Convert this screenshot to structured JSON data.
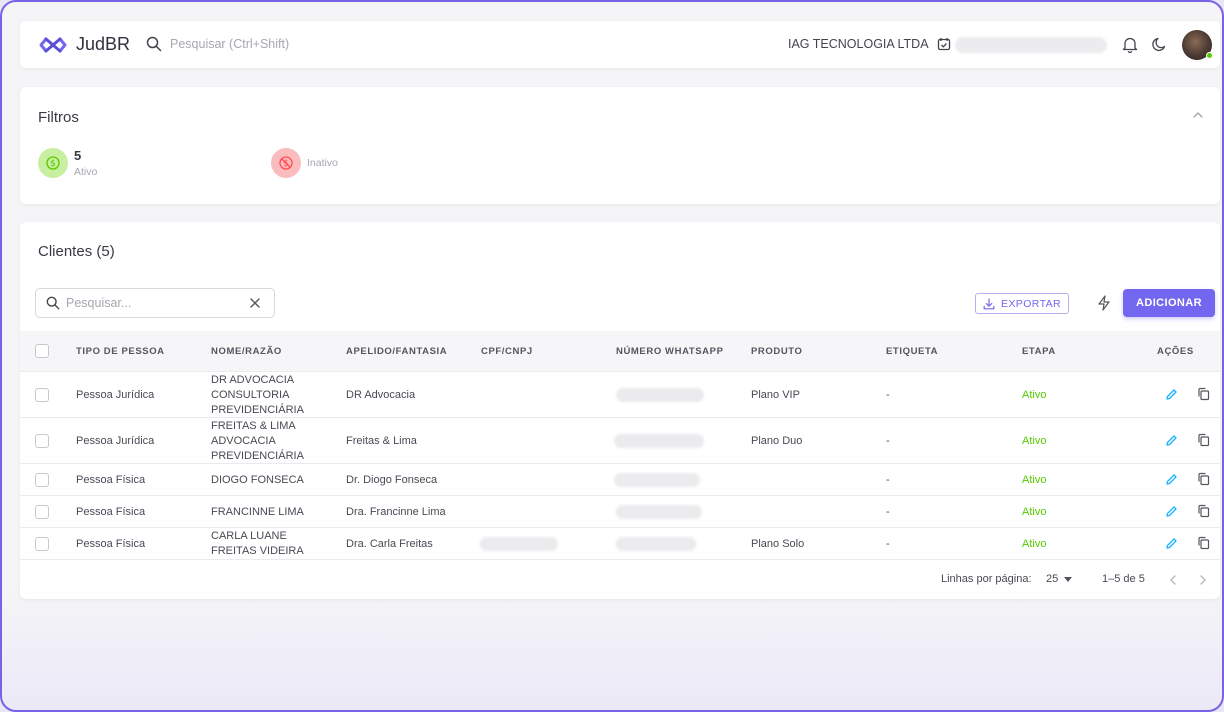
{
  "app": {
    "name": "JudBR"
  },
  "topbar": {
    "search_placeholder": "Pesquisar (Ctrl+Shift)",
    "company": "IAG TECNOLOGIA LTDA"
  },
  "filters": {
    "title": "Filtros",
    "active": {
      "count": "5",
      "label": "Ativo"
    },
    "inactive": {
      "label": "Inativo"
    }
  },
  "clients": {
    "title": "Clientes (5)",
    "search_placeholder": "Pesquisar...",
    "export_label": "EXPORTAR",
    "add_label": "ADICIONAR",
    "columns": [
      "TIPO DE PESSOA",
      "NOME/RAZÃO",
      "APELIDO/FANTASIA",
      "CPF/CNPJ",
      "NÚMERO WHATSAPP",
      "PRODUTO",
      "ETIQUETA",
      "ETAPA",
      "AÇÕES"
    ],
    "rows": [
      {
        "tipo": "Pessoa Jurídica",
        "nome": "DR ADVOCACIA CONSULTORIA PREVIDENCIÁRIA",
        "apelido": "DR Advocacia",
        "produto": "Plano VIP",
        "etiqueta": "-",
        "etapa": "Ativo"
      },
      {
        "tipo": "Pessoa Jurídica",
        "nome": "FREITAS & LIMA ADVOCACIA PREVIDENCIÁRIA",
        "apelido": "Freitas & Lima",
        "produto": "Plano Duo",
        "etiqueta": "-",
        "etapa": "Ativo"
      },
      {
        "tipo": "Pessoa Física",
        "nome": "DIOGO FONSECA",
        "apelido": "Dr. Diogo Fonseca",
        "produto": "",
        "etiqueta": "-",
        "etapa": "Ativo"
      },
      {
        "tipo": "Pessoa Física",
        "nome": "FRANCINNE LIMA",
        "apelido": "Dra. Francinne Lima",
        "produto": "",
        "etiqueta": "-",
        "etapa": "Ativo"
      },
      {
        "tipo": "Pessoa Física",
        "nome": "CARLA LUANE FREITAS VIDEIRA",
        "apelido": "Dra. Carla Freitas",
        "produto": "Plano Solo",
        "etiqueta": "-",
        "etapa": "Ativo"
      }
    ],
    "footer": {
      "rows_per_page_label": "Linhas por página:",
      "rows_per_page": "25",
      "range": "1–5 de 5"
    }
  },
  "colors": {
    "accent": "#7367f0",
    "success": "#56ca00",
    "danger": "#ff4c51"
  },
  "icons": [
    "logo-icon",
    "search-icon",
    "calendar-check-icon",
    "bell-icon",
    "moon-icon",
    "chevron-up-icon",
    "dollar-circle-icon",
    "dollar-off-icon",
    "close-icon",
    "download-icon",
    "bolt-icon",
    "pencil-icon",
    "copy-icon",
    "caret-down-icon",
    "chevron-left-icon",
    "chevron-right-icon"
  ]
}
